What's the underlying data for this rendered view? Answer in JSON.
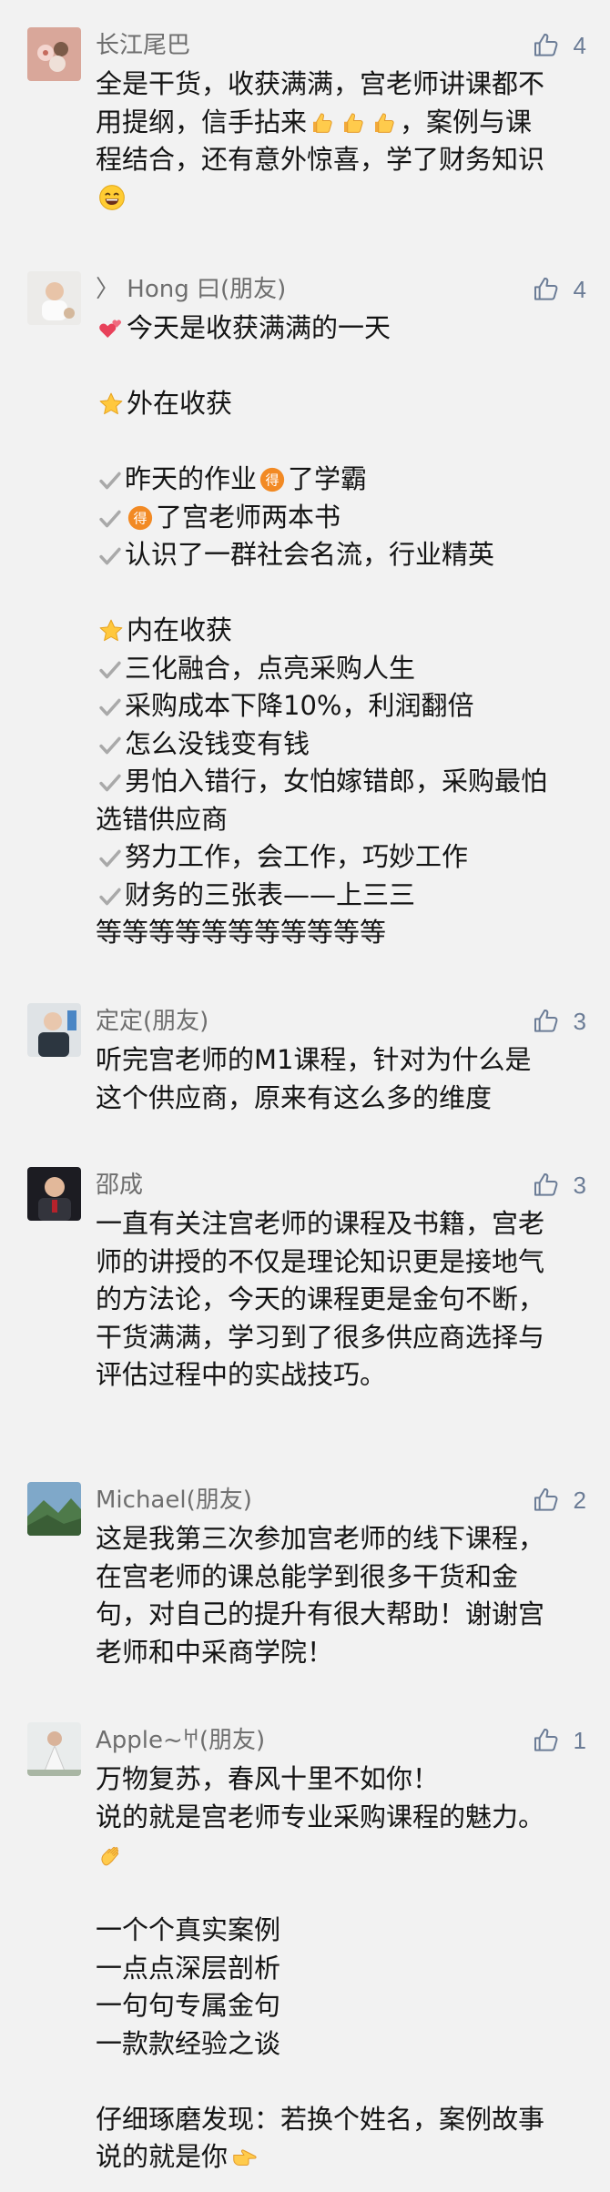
{
  "comments": [
    {
      "author": "长江尾巴",
      "likes": "4",
      "lines": [
        "全是干货，收获满满，宫老师讲课都不",
        "用提纲，信手拈来👍👍👍，案例与课",
        "程结合，还有意外惊喜，学了财务知识",
        "😄"
      ]
    },
    {
      "author": "〉 Hong 曰(朋友)",
      "likes": "4",
      "lines": [
        "💕今天是收获满满的一天",
        "",
        "⭐外在收获",
        "",
        "✔️昨天的作业🉐了学霸",
        "✔️🉐了宫老师两本书",
        "✔️认识了一群社会名流，行业精英",
        "",
        "⭐内在收获",
        "✔️三化融合，点亮采购人生",
        "✔️采购成本下降10%，利润翻倍",
        "✔️怎么没钱变有钱",
        "✔️男怕入错行，女怕嫁错郎，采购最怕",
        "选错供应商",
        "✔️努力工作，会工作，巧妙工作",
        "✔️财务的三张表——上三三",
        "等等等等等等等等等等等"
      ]
    },
    {
      "author": "定定(朋友)",
      "likes": "3",
      "lines": [
        "听完宫老师的M1课程，针对为什么是",
        "这个供应商，原来有这么多的维度"
      ]
    },
    {
      "author": "邵成",
      "likes": "3",
      "lines": [
        "一直有关注宫老师的课程及书籍，宫老",
        "师的讲授的不仅是理论知识更是接地气",
        "的方法论，今天的课程更是金句不断，",
        "干货满满，学习到了很多供应商选择与",
        "评估过程中的实战技巧。"
      ]
    },
    {
      "author": "Michael(朋友)",
      "likes": "2",
      "lines": [
        "这是我第三次参加宫老师的线下课程，",
        "在宫老师的课总能学到很多干货和金",
        "句，对自己的提升有很大帮助！谢谢宫",
        "老师和中采商学院！"
      ]
    },
    {
      "author": "Apple~𐀀(朋友)",
      "likes": "1",
      "lines": [
        "万物复苏，春风十里不如你！",
        "说的就是宫老师专业采购课程的魅力。",
        "👏",
        "",
        "一个个真实案例",
        "一点点深层剖析",
        "一句句专属金句",
        "一款款经验之谈",
        "",
        "仔细琢磨发现：若换个姓名，案例故事",
        "说的就是你👉"
      ]
    }
  ],
  "icons": {
    "like": "thumbs-up-outline-icon",
    "thumbs_up_emoji": "thumbs-up-emoji",
    "grin_emoji": "grinning-face-emoji",
    "hearts_emoji": "two-hearts-emoji",
    "star_emoji": "star-emoji",
    "check_emoji": "check-mark-emoji",
    "de_emoji": "circled-de-emoji",
    "clap_emoji": "clapping-hands-emoji",
    "point_emoji": "pointing-right-emoji"
  },
  "colors": {
    "background": "#f2f2f2",
    "author": "#6e6e6e",
    "like_icon": "#6b7c96",
    "text": "#141414"
  }
}
